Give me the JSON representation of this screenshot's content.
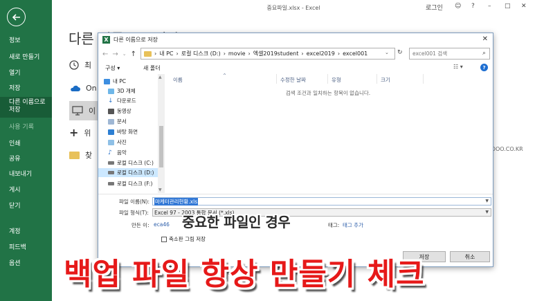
{
  "window": {
    "title": "중요파일.xlsx  -  Excel",
    "user": "로그인"
  },
  "backstage": {
    "items": [
      {
        "label": "정보"
      },
      {
        "label": "새로 만들기"
      },
      {
        "label": "열기"
      },
      {
        "label": "저장"
      },
      {
        "label": "다른 이름으로 저장"
      },
      {
        "label": "사용 기록"
      },
      {
        "label": "인쇄"
      },
      {
        "label": "공유"
      },
      {
        "label": "내보내기"
      },
      {
        "label": "게시"
      },
      {
        "label": "닫기"
      },
      {
        "label": "계정"
      },
      {
        "label": "피드백"
      },
      {
        "label": "옵션"
      }
    ],
    "heading": "다른 이름으로 저장",
    "rows": [
      "최",
      "On",
      "이",
      "위",
      "찾"
    ]
  },
  "watermark": "ALOOO.CO.KR",
  "dialog": {
    "title": "다른 이름으로 저장",
    "path": [
      "내 PC",
      "로컬 디스크 (D:)",
      "movie",
      "엑셀2019student",
      "excel2019",
      "excel001"
    ],
    "search_placeholder": "excel001 검색",
    "toolbar": {
      "organize": "구성 ▾",
      "new_folder": "새 폴더"
    },
    "nav_items": [
      "내 PC",
      "3D 개체",
      "다운로드",
      "동영상",
      "문서",
      "바탕 화면",
      "사진",
      "음악",
      "로컬 디스크 (C:)",
      "로컬 디스크 (D:)",
      "로컬 디스크 (F:)"
    ],
    "columns": [
      "이름",
      "수정한 날짜",
      "유형",
      "크기"
    ],
    "empty_message": "검색 조건과 일치하는 항목이 없습니다.",
    "filename_label": "파일 이름(N):",
    "filename_value": "마케터관리현황.xls",
    "filetype_label": "파일 형식(T):",
    "filetype_value": "Excel 97 - 2003 통합 문서 (*.xls)",
    "author_label": "만든 이:",
    "author_value": "eca46",
    "tag_label": "태그:",
    "tag_value": "태그 추가",
    "thumbnail_label": "축소판 그림 저장",
    "save_label": "저장",
    "cancel_label": "취소"
  },
  "captions": {
    "small": "중요한 파일인 경우",
    "big": "백업 파일 항상 만들기 체크"
  }
}
